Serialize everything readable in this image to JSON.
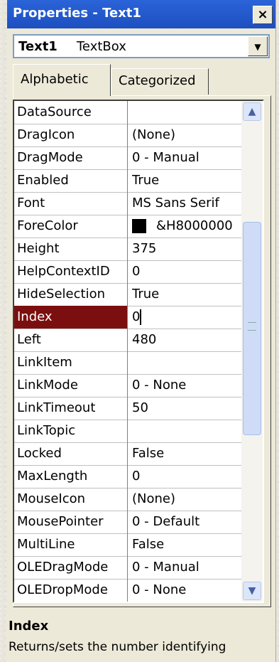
{
  "window": {
    "title": "Properties - Text1",
    "close_label": "×"
  },
  "object_selector": {
    "name": "Text1",
    "type": "TextBox"
  },
  "tabs": [
    {
      "label": "Alphabetic",
      "active": true
    },
    {
      "label": "Categorized",
      "active": false
    }
  ],
  "properties": [
    {
      "name": "DataSource",
      "value": ""
    },
    {
      "name": "DragIcon",
      "value": "(None)"
    },
    {
      "name": "DragMode",
      "value": "0 - Manual"
    },
    {
      "name": "Enabled",
      "value": "True"
    },
    {
      "name": "Font",
      "value": "MS Sans Serif"
    },
    {
      "name": "ForeColor",
      "value": "&H8000000"
    },
    {
      "name": "Height",
      "value": "375"
    },
    {
      "name": "HelpContextID",
      "value": "0"
    },
    {
      "name": "HideSelection",
      "value": "True"
    },
    {
      "name": "Index",
      "value": "0"
    },
    {
      "name": "Left",
      "value": "480"
    },
    {
      "name": "LinkItem",
      "value": ""
    },
    {
      "name": "LinkMode",
      "value": "0 - None"
    },
    {
      "name": "LinkTimeout",
      "value": "50"
    },
    {
      "name": "LinkTopic",
      "value": ""
    },
    {
      "name": "Locked",
      "value": "False"
    },
    {
      "name": "MaxLength",
      "value": "0"
    },
    {
      "name": "MouseIcon",
      "value": "(None)"
    },
    {
      "name": "MousePointer",
      "value": "0 - Default"
    },
    {
      "name": "MultiLine",
      "value": "False"
    },
    {
      "name": "OLEDragMode",
      "value": "0 - Manual"
    },
    {
      "name": "OLEDropMode",
      "value": "0 - None"
    }
  ],
  "selected_property": "Index",
  "colors": {
    "forecolor_swatch": "#000000",
    "selected_row": "#7b0f0f"
  },
  "description": {
    "title": "Index",
    "text": "Returns/sets the number identifying"
  }
}
